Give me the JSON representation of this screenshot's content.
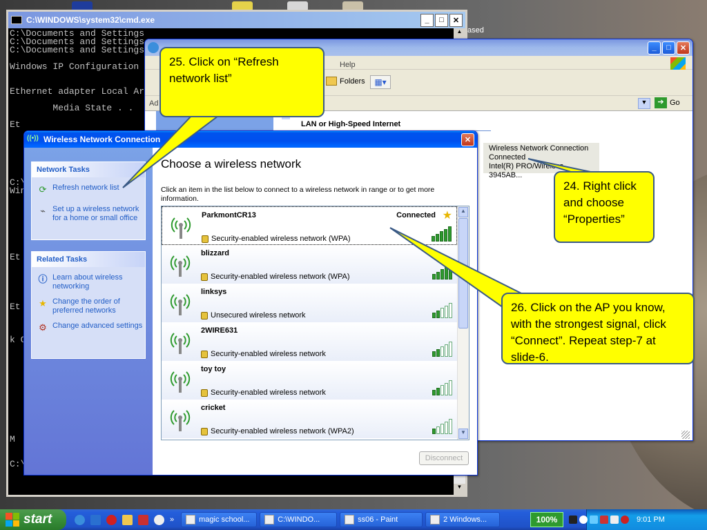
{
  "cmd": {
    "title": "C:\\WINDOWS\\system32\\cmd.exe",
    "lines": "C:\\Documents and Settings\nC:\\Documents and Settings\nC:\\Documents and Settings\n\nWindows IP Configuration\n\n\nEthernet adapter Local Ar\n\n        Media State . .\n\nEt\n\n\n\n\n\n\nC:\\\nWin\n\n\n\n\n\n\n\nEt\n\n\n\n\n\nEt\n\n\n\nk C\n\n\n\n\n\n\n\n\n\n\n\nM\n\n\nC:\\Documents and Settings\\ADMIN>",
    "right_text": "ased"
  },
  "netconn": {
    "menu_help": "Help",
    "ad": "Ad",
    "folders_label": "Folders",
    "go_label": "Go",
    "group_header": "LAN or High-Speed Internet",
    "item": {
      "name": "Wireless Network Connection",
      "status": "Connected",
      "device": "Intel(R) PRO/Wireless 3945AB..."
    }
  },
  "wireless": {
    "title": "Wireless Network Connection",
    "network_tasks_header": "Network Tasks",
    "refresh_label": "Refresh network list",
    "setup_label": "Set up a wireless network for a home or small office",
    "related_header": "Related Tasks",
    "learn_label": "Learn about wireless networking",
    "order_label": "Change the order of preferred networks",
    "advanced_label": "Change advanced settings",
    "heading": "Choose a wireless network",
    "description": "Click an item in the list below to connect to a wireless network in range or to get more information.",
    "disconnect_label": "Disconnect",
    "networks": [
      {
        "name": "ParkmontCR13",
        "security": "Security-enabled wireless network (WPA)",
        "status": "Connected",
        "bars": 5
      },
      {
        "name": "blizzard",
        "security": "Security-enabled wireless network (WPA)",
        "status": "",
        "bars": 5
      },
      {
        "name": "linksys",
        "security": "Unsecured wireless network",
        "status": "",
        "bars": 2
      },
      {
        "name": "2WIRE631",
        "security": "Security-enabled wireless network",
        "status": "",
        "bars": 2
      },
      {
        "name": "toy toy",
        "security": "Security-enabled wireless network",
        "status": "",
        "bars": 2
      },
      {
        "name": "cricket",
        "security": "Security-enabled wireless network (WPA2)",
        "status": "",
        "bars": 1
      }
    ]
  },
  "callouts": {
    "c25": "25. Click on “Refresh network list”",
    "c24": "24. Right click and choose “Properties”",
    "c26": "26. Click on the AP you know, with the strongest signal, click “Connect”. Repeat step-7 at slide-6."
  },
  "taskbar": {
    "start_label": "start",
    "items": [
      "magic school...",
      "C:\\WINDO...",
      "ss06 - Paint",
      "2 Windows..."
    ],
    "zoom": "100%",
    "clock": "9:01 PM"
  }
}
